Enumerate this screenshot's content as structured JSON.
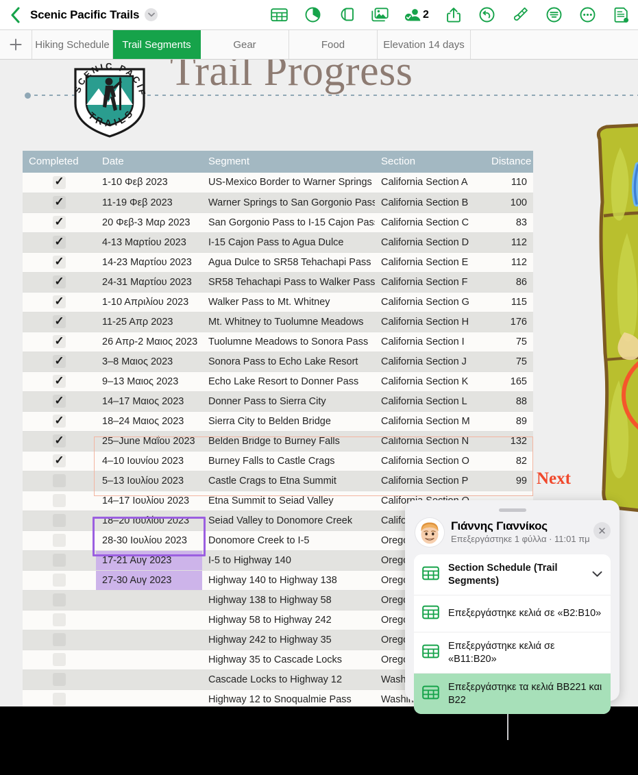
{
  "topbar": {
    "back_icon": "chevron-left-icon",
    "doc_title": "Scenic Pacific Trails",
    "title_caret_icon": "chevron-down-icon",
    "tools": [
      {
        "name": "insert-table-icon",
        "label": "Table"
      },
      {
        "name": "insert-chart-icon",
        "label": "Chart"
      },
      {
        "name": "insert-shape-icon",
        "label": "Shape"
      },
      {
        "name": "insert-media-icon",
        "label": "Media"
      },
      {
        "name": "collaborate-icon",
        "label": "Collaborate"
      },
      {
        "name": "share-icon",
        "label": "Share"
      },
      {
        "name": "undo-icon",
        "label": "Undo"
      },
      {
        "name": "format-brush-icon",
        "label": "Format"
      },
      {
        "name": "organize-icon",
        "label": "Organize"
      },
      {
        "name": "more-icon",
        "label": "More"
      },
      {
        "name": "document-options-icon",
        "label": "Document"
      }
    ],
    "collab_count": "2"
  },
  "tabbar": {
    "add_icon": "plus-icon",
    "tabs": [
      {
        "label": "Hiking Schedule",
        "active": false
      },
      {
        "label": "Trail Segments",
        "active": true
      },
      {
        "label": "Gear",
        "active": false
      },
      {
        "label": "Food",
        "active": false
      },
      {
        "label": "Elevation 14 days",
        "active": false
      }
    ]
  },
  "canvas": {
    "sheet_title": "Trail Progress",
    "logo_text_top": "SCENIC PACIFIC",
    "logo_text_bottom": "TRAILS",
    "next_label": "Next"
  },
  "colors": {
    "accent_green": "#16a34a",
    "header_blue_gray": "#a3b8c2",
    "selection_purple": "#9b5fe0",
    "selection_purple_fill": "#cdb4ea",
    "comment_range": "#f3b5a0",
    "next_red": "#f0492c",
    "highlight_green": "#a7e0b9",
    "title_brown": "#8d7b72",
    "logo_teal": "#2a9d8f"
  },
  "table": {
    "columns": [
      "Completed",
      "Date",
      "Segment",
      "Section",
      "Distance"
    ],
    "rows": [
      {
        "completed": true,
        "date": "1-10 Φεβ 2023",
        "segment": "US-Mexico Border to Warner Springs",
        "section": "California Section A",
        "distance": "110"
      },
      {
        "completed": true,
        "date": "11-19 Φεβ 2023",
        "segment": "Warner Springs to San Gorgonio Pass",
        "section": "California Section B",
        "distance": "100"
      },
      {
        "completed": true,
        "date": "20 Φεβ-3 Μαρ 2023",
        "segment": "San Gorgonio Pass to I-15 Cajon Pass",
        "section": "California Section C",
        "distance": "83"
      },
      {
        "completed": true,
        "date": "4-13 Μαρτίου 2023",
        "segment": "I-15 Cajon Pass to Agua Dulce",
        "section": "California Section D",
        "distance": "112"
      },
      {
        "completed": true,
        "date": "14-23 Μαρτίου 2023",
        "segment": "Agua Dulce to SR58 Tehachapi Pass",
        "section": "California Section E",
        "distance": "112"
      },
      {
        "completed": true,
        "date": "24-31 Μαρτίου 2023",
        "segment": "SR58 Tehachapi Pass to Walker Pass",
        "section": "California Section F",
        "distance": "86"
      },
      {
        "completed": true,
        "date": "1-10 Απριλίου 2023",
        "segment": "Walker Pass to Mt. Whitney",
        "section": "California Section G",
        "distance": "115"
      },
      {
        "completed": true,
        "date": "11-25 Απρ 2023",
        "segment": "Mt. Whitney to Tuolumne Meadows",
        "section": "California Section H",
        "distance": "176"
      },
      {
        "completed": true,
        "date": "26 Απρ-2 Μαιος 2023",
        "segment": "Tuolumne Meadows to Sonora Pass",
        "section": "California Section I",
        "distance": "75"
      },
      {
        "completed": true,
        "date": "3–8 Μαιος 2023",
        "segment": "Sonora Pass to Echo Lake Resort",
        "section": "California Section J",
        "distance": "75"
      },
      {
        "completed": true,
        "date": "9–13 Μαιος 2023",
        "segment": "Echo Lake Resort to Donner Pass",
        "section": "California Section K",
        "distance": "165"
      },
      {
        "completed": true,
        "date": "14–17 Μαιος 2023",
        "segment": "Donner Pass to Sierra City",
        "section": "California Section L",
        "distance": "88"
      },
      {
        "completed": true,
        "date": "18–24 Μαιος 2023",
        "segment": "Sierra City to Belden Bridge",
        "section": "California Section M",
        "distance": "89"
      },
      {
        "completed": true,
        "date": "25–June Μαΐου 2023",
        "segment": "Belden Bridge to Burney Falls",
        "section": "California Section N",
        "distance": "132"
      },
      {
        "completed": true,
        "date": "4–10 Ιουνίου 2023",
        "segment": "Burney Falls to Castle Crags",
        "section": "California Section O",
        "distance": "82"
      },
      {
        "completed": false,
        "date": "5–13 Ιουλίου 2023",
        "segment": "Castle Crags to Etna Summit",
        "section": "California Section P",
        "distance": "99"
      },
      {
        "completed": false,
        "date": "14–17 Ιουλίου 2023",
        "segment": "Etna Summit to Seiad Valley",
        "section": "California Section Q",
        "distance": ""
      },
      {
        "completed": false,
        "date": "18–20 Ιουλίου 2023",
        "segment": "Seiad Valley to Donomore Creek",
        "section": "California Section R",
        "distance": ""
      },
      {
        "completed": false,
        "date": "28-30 Ιουλίου 2023",
        "segment": "Donomore Creek to I-5",
        "section": "Oregon Section A",
        "distance": ""
      },
      {
        "completed": false,
        "date": "17-21 Αυγ 2023",
        "segment": "I-5 to Highway 140",
        "section": "Oregon Section B",
        "distance": "",
        "selected": true
      },
      {
        "completed": false,
        "date": "27-30 Αυγ 2023",
        "segment": "Highway 140 to Highway 138",
        "section": "Oregon Section C",
        "distance": "",
        "selected": true
      },
      {
        "completed": false,
        "date": "",
        "segment": "Highway 138 to Highway 58",
        "section": "Oregon Section D",
        "distance": ""
      },
      {
        "completed": false,
        "date": "",
        "segment": "Highway 58 to Highway 242",
        "section": "Oregon Section E",
        "distance": ""
      },
      {
        "completed": false,
        "date": "",
        "segment": "Highway 242 to Highway 35",
        "section": "Oregon Section F",
        "distance": ""
      },
      {
        "completed": false,
        "date": "",
        "segment": "Highway 35 to Cascade Locks",
        "section": "Oregon Section G",
        "distance": ""
      },
      {
        "completed": false,
        "date": "",
        "segment": "Cascade Locks to Highway 12",
        "section": "Washington Section A",
        "distance": ""
      },
      {
        "completed": false,
        "date": "",
        "segment": "Highway 12 to Snoqualmie Pass",
        "section": "Washington Section B",
        "distance": ""
      }
    ]
  },
  "popover": {
    "grabber_icon": "drag-handle-icon",
    "avatar_icon": "user-avatar",
    "name": "Γιάννης Γιαννίκος",
    "subtitle": "Επεξεργάστηκε 1 φύλλα · 11:01 πμ",
    "close_icon": "close-icon",
    "items": [
      {
        "icon": "table-icon",
        "text": "Section Schedule (Trail Segments)",
        "bold": true,
        "chevron": true,
        "highlight": false
      },
      {
        "icon": "table-icon",
        "text": "Επεξεργάστηκε κελιά σε «B2:B10»",
        "bold": false,
        "chevron": false,
        "highlight": false
      },
      {
        "icon": "table-icon",
        "text": "Επεξεργάστηκε κελιά σε «B11:B20»",
        "bold": false,
        "chevron": false,
        "highlight": false
      },
      {
        "icon": "table-icon",
        "text": "Επεξεργάστηκε τα κελιά BB221 και B22",
        "bold": false,
        "chevron": false,
        "highlight": true
      }
    ]
  }
}
